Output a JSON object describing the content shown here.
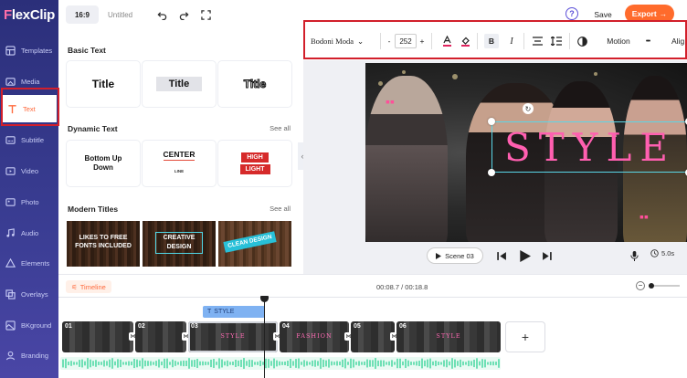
{
  "app": {
    "logo_prefix": "F",
    "logo_rest": "lexClip"
  },
  "rail": [
    {
      "label": "Templates",
      "icon": "templates-icon"
    },
    {
      "label": "Media",
      "icon": "media-icon"
    },
    {
      "label": "Text",
      "icon": "text-icon",
      "active": true
    },
    {
      "label": "Subtitle",
      "icon": "subtitle-icon"
    },
    {
      "label": "Video",
      "icon": "video-icon"
    },
    {
      "label": "Photo",
      "icon": "photo-icon"
    },
    {
      "label": "Audio",
      "icon": "audio-icon"
    },
    {
      "label": "Elements",
      "icon": "elements-icon"
    },
    {
      "label": "Overlays",
      "icon": "overlays-icon"
    },
    {
      "label": "BKground",
      "icon": "background-icon"
    },
    {
      "label": "Branding",
      "icon": "branding-icon"
    }
  ],
  "header": {
    "ratio": "16:9",
    "project_title": "Untitled",
    "help": "?",
    "save": "Save",
    "export": "Export"
  },
  "panel": {
    "basic_title": "Basic Text",
    "basic": [
      "Title",
      "Title",
      "Title"
    ],
    "dynamic_title": "Dynamic Text",
    "dynamic_see_all": "See all",
    "dynamic": {
      "bottom_up": "Bottom Up Down",
      "center": "CENTER",
      "center_sub": "LINE",
      "high": "HIGH",
      "light": "LIGHT"
    },
    "modern_title": "Modern Titles",
    "modern_see_all": "See all",
    "modern": {
      "m1": "LIKES TO FREE FONTS INCLUDED",
      "m2": "CREATIVE DESIGN",
      "m3": "CLEAN DESIGN"
    }
  },
  "toolbar": {
    "font": "Bodoni Moda",
    "minus": "-",
    "size": "252",
    "plus": "+",
    "bold": "B",
    "italic": "I",
    "motion": "Motion",
    "more": "•••",
    "align": "Alig"
  },
  "canvas": {
    "text": "STYLE"
  },
  "controls": {
    "scene": "Scene 03",
    "duration": "5.0s"
  },
  "timeline": {
    "label": "Timeline",
    "time": "00:08.7 / 00:18.8",
    "text_track": "STYLE",
    "clips": [
      {
        "num": "01",
        "label": ""
      },
      {
        "num": "02",
        "label": ""
      },
      {
        "num": "03",
        "label": "STYLE"
      },
      {
        "num": "04",
        "label": "FASHION"
      },
      {
        "num": "05",
        "label": ""
      },
      {
        "num": "06",
        "label": "STYLE"
      }
    ],
    "add": "+"
  },
  "colors": {
    "accent": "#ff6a3d",
    "rail": "#2b2f7a",
    "style_pink": "#ff5fb0",
    "highlight_red": "#d21f2b"
  }
}
